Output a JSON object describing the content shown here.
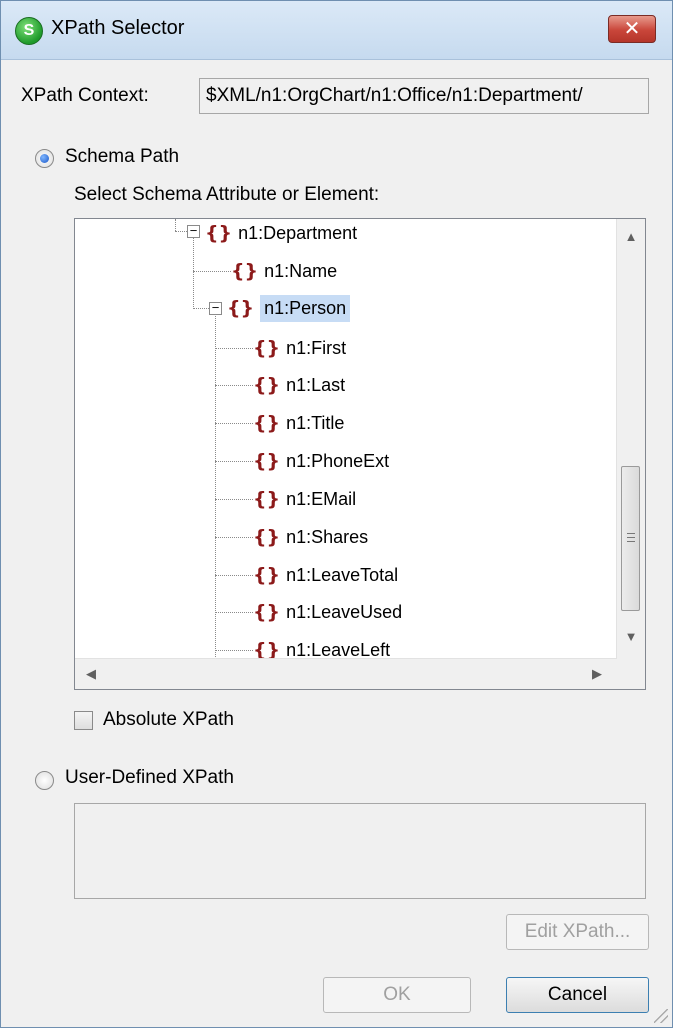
{
  "window": {
    "title": "XPath Selector",
    "app_icon_glyph": "S",
    "close_glyph": "✕"
  },
  "context": {
    "label": "XPath Context:",
    "value": "$XML/n1:OrgChart/n1:Office/n1:Department/"
  },
  "schema_path": {
    "label": "Schema Path",
    "selected": true,
    "select_label": "Select Schema Attribute or Element:",
    "tree": {
      "root": {
        "label": "n1:Department",
        "expander": "−"
      },
      "name": {
        "label": "n1:Name"
      },
      "person": {
        "label": "n1:Person",
        "expander": "−",
        "selected": true
      },
      "children": [
        {
          "label": "n1:First"
        },
        {
          "label": "n1:Last"
        },
        {
          "label": "n1:Title"
        },
        {
          "label": "n1:PhoneExt"
        },
        {
          "label": "n1:EMail"
        },
        {
          "label": "n1:Shares"
        },
        {
          "label": "n1:LeaveTotal"
        },
        {
          "label": "n1:LeaveUsed"
        },
        {
          "label": "n1:LeaveLeft"
        }
      ],
      "element_glyph": "{}"
    },
    "scroll": {
      "up": "▲",
      "down": "▼",
      "left": "◀",
      "right": "▶"
    }
  },
  "absolute_xpath": {
    "label": "Absolute XPath",
    "checked": false
  },
  "user_defined": {
    "label": "User-Defined XPath",
    "selected": false,
    "value": ""
  },
  "buttons": {
    "edit_xpath": "Edit XPath...",
    "ok": "OK",
    "cancel": "Cancel"
  },
  "colors": {
    "selection": "#c7dcf5",
    "element_icon": "#8c1a1a",
    "close_button": "#c9463a"
  }
}
